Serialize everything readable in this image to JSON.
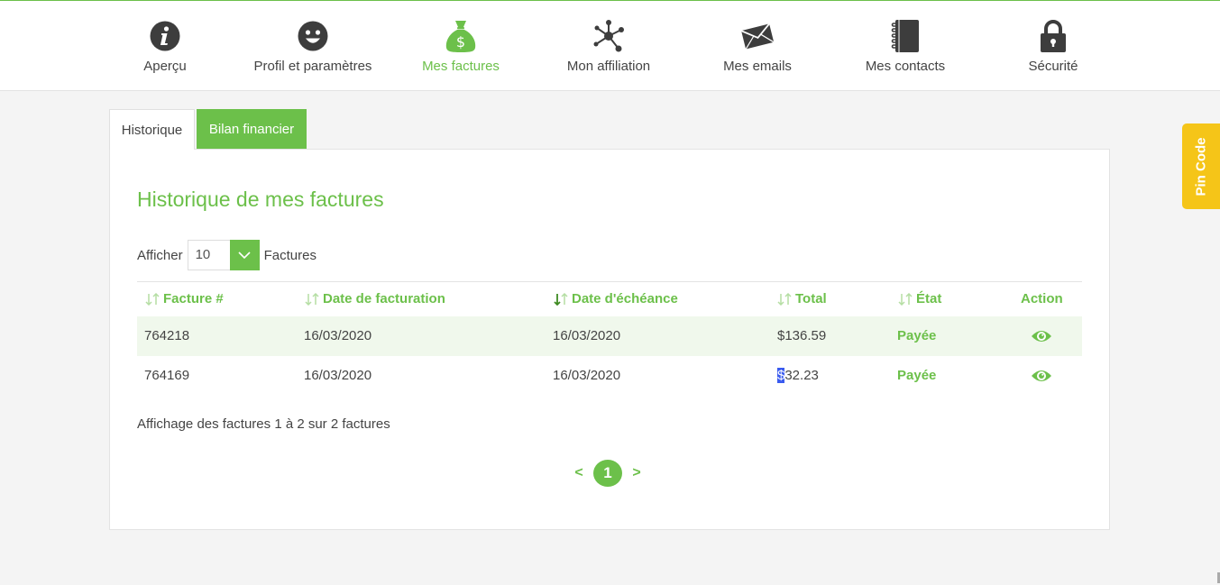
{
  "nav": {
    "items": [
      {
        "label": "Aperçu",
        "icon": "info-icon"
      },
      {
        "label": "Profil et paramètres",
        "icon": "smiley-icon"
      },
      {
        "label": "Mes factures",
        "icon": "money-bag-icon",
        "active": true
      },
      {
        "label": "Mon affiliation",
        "icon": "network-icon"
      },
      {
        "label": "Mes emails",
        "icon": "envelope-icon"
      },
      {
        "label": "Mes contacts",
        "icon": "address-book-icon"
      },
      {
        "label": "Sécurité",
        "icon": "lock-icon"
      }
    ]
  },
  "tabs": {
    "historique": "Historique",
    "bilan": "Bilan financier"
  },
  "panel": {
    "title": "Historique de mes factures",
    "show_label": "Afficher",
    "page_size": "10",
    "show_suffix": "Factures"
  },
  "table": {
    "headers": {
      "facture": "Facture #",
      "date_facturation": "Date de facturation",
      "date_echeance": "Date d'échéance",
      "total": "Total",
      "etat": "État",
      "action": "Action"
    },
    "rows": [
      {
        "facture": "764218",
        "date_facturation": "16/03/2020",
        "date_echeance": "16/03/2020",
        "total_sym": "$",
        "total_val": "136.59",
        "etat": "Payée"
      },
      {
        "facture": "764169",
        "date_facturation": "16/03/2020",
        "date_echeance": "16/03/2020",
        "total_sym": "$",
        "total_val": "32.23",
        "etat": "Payée"
      }
    ]
  },
  "summary": "Affichage des factures 1 à 2 sur 2 factures",
  "pagination": {
    "prev": "<",
    "current": "1",
    "next": ">"
  },
  "pin_code": "Pin Code",
  "colors": {
    "accent": "#6cc04a",
    "pin": "#f5c518",
    "icon_dark": "#3d3d3d"
  }
}
